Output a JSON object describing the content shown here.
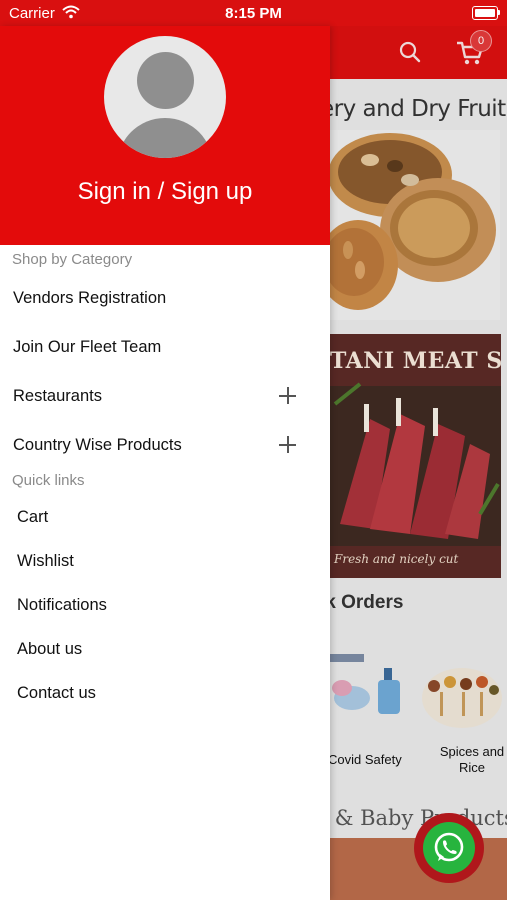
{
  "status_bar": {
    "carrier": "Carrier",
    "time": "8:15 PM"
  },
  "background": {
    "cart_count": "0",
    "dry_fruits_title": "ery and Dry Fruits",
    "meat_shop_title": "TANI MEAT SHOP",
    "meat_caption": "Fresh and nicely cut",
    "bulk_orders_title": "lk Orders",
    "categories": [
      {
        "label": "Covid Safety"
      },
      {
        "label": "Spices and Rice"
      }
    ],
    "baby_products_title": "r & Baby Products"
  },
  "drawer": {
    "sign_in_label": "Sign in / Sign up",
    "shop_by_category_title": "Shop by Category",
    "category_items": [
      {
        "label": "Vendors Registration"
      },
      {
        "label": "Join Our Fleet Team"
      },
      {
        "label": "Restaurants"
      },
      {
        "label": "Country Wise Products"
      }
    ],
    "quick_links_title": "Quick links",
    "quick_links": [
      {
        "label": "Cart"
      },
      {
        "label": "Wishlist"
      },
      {
        "label": "Notifications"
      },
      {
        "label": "About us"
      },
      {
        "label": "Contact us"
      }
    ]
  },
  "colors": {
    "brand_red": "#e30b0b",
    "whatsapp_green": "#27b43e"
  }
}
